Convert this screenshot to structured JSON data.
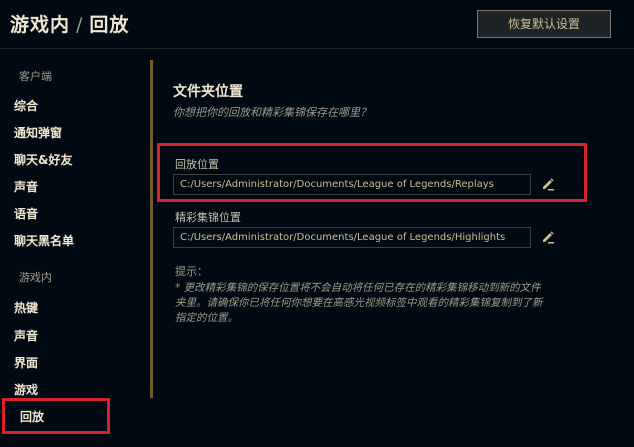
{
  "header": {
    "breadcrumb_parent": "游戏内",
    "breadcrumb_sep": "/",
    "breadcrumb_current": "回放",
    "restore_button": "恢复默认设置"
  },
  "sidebar": {
    "client_section": "客户端",
    "client_items": [
      "综合",
      "通知弹窗",
      "聊天&好友",
      "声音",
      "语音",
      "聊天黑名单"
    ],
    "ingame_section": "游戏内",
    "ingame_items": [
      "热键",
      "声音",
      "界面",
      "游戏",
      "回放"
    ],
    "active_item": "回放"
  },
  "main": {
    "title": "文件夹位置",
    "subtitle": "你想把你的回放和精彩集锦保存在哪里？",
    "replay": {
      "label": "回放位置",
      "path": "C:/Users/Administrator/Documents/League of Legends/Replays"
    },
    "highlight": {
      "label": "精彩集锦位置",
      "path": "C:/Users/Administrator/Documents/League of Legends/Highlights"
    },
    "tips_label": "提示：",
    "tips_text": "* 更改精彩集锦的保存位置将不会自动将任何已存在的精彩集锦移动到新的文件夹里。请确保你已将任何你想要在高感光视频标签中观看的精彩集锦复制到了新指定的位置。"
  },
  "icons": {
    "edit": "pencil-icon"
  },
  "colors": {
    "background": "#010a13",
    "gold_accent": "#785a28",
    "highlight_red": "#d9232b",
    "text_primary": "#f0e6d2",
    "text_muted": "#a09b8c"
  }
}
